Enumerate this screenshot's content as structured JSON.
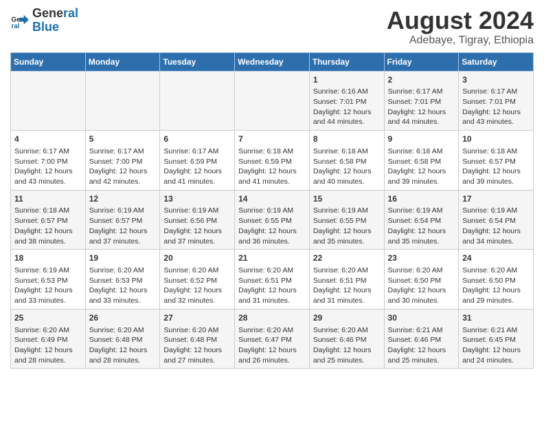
{
  "header": {
    "logo_line1": "General",
    "logo_line2": "Blue",
    "title": "August 2024",
    "subtitle": "Adebaye, Tigray, Ethiopia"
  },
  "calendar": {
    "days_of_week": [
      "Sunday",
      "Monday",
      "Tuesday",
      "Wednesday",
      "Thursday",
      "Friday",
      "Saturday"
    ],
    "weeks": [
      [
        {
          "day": "",
          "info": ""
        },
        {
          "day": "",
          "info": ""
        },
        {
          "day": "",
          "info": ""
        },
        {
          "day": "",
          "info": ""
        },
        {
          "day": "1",
          "info": "Sunrise: 6:16 AM\nSunset: 7:01 PM\nDaylight: 12 hours and 44 minutes."
        },
        {
          "day": "2",
          "info": "Sunrise: 6:17 AM\nSunset: 7:01 PM\nDaylight: 12 hours and 44 minutes."
        },
        {
          "day": "3",
          "info": "Sunrise: 6:17 AM\nSunset: 7:01 PM\nDaylight: 12 hours and 43 minutes."
        }
      ],
      [
        {
          "day": "4",
          "info": "Sunrise: 6:17 AM\nSunset: 7:00 PM\nDaylight: 12 hours and 43 minutes."
        },
        {
          "day": "5",
          "info": "Sunrise: 6:17 AM\nSunset: 7:00 PM\nDaylight: 12 hours and 42 minutes."
        },
        {
          "day": "6",
          "info": "Sunrise: 6:17 AM\nSunset: 6:59 PM\nDaylight: 12 hours and 41 minutes."
        },
        {
          "day": "7",
          "info": "Sunrise: 6:18 AM\nSunset: 6:59 PM\nDaylight: 12 hours and 41 minutes."
        },
        {
          "day": "8",
          "info": "Sunrise: 6:18 AM\nSunset: 6:58 PM\nDaylight: 12 hours and 40 minutes."
        },
        {
          "day": "9",
          "info": "Sunrise: 6:18 AM\nSunset: 6:58 PM\nDaylight: 12 hours and 39 minutes."
        },
        {
          "day": "10",
          "info": "Sunrise: 6:18 AM\nSunset: 6:57 PM\nDaylight: 12 hours and 39 minutes."
        }
      ],
      [
        {
          "day": "11",
          "info": "Sunrise: 6:18 AM\nSunset: 6:57 PM\nDaylight: 12 hours and 38 minutes."
        },
        {
          "day": "12",
          "info": "Sunrise: 6:19 AM\nSunset: 6:57 PM\nDaylight: 12 hours and 37 minutes."
        },
        {
          "day": "13",
          "info": "Sunrise: 6:19 AM\nSunset: 6:56 PM\nDaylight: 12 hours and 37 minutes."
        },
        {
          "day": "14",
          "info": "Sunrise: 6:19 AM\nSunset: 6:55 PM\nDaylight: 12 hours and 36 minutes."
        },
        {
          "day": "15",
          "info": "Sunrise: 6:19 AM\nSunset: 6:55 PM\nDaylight: 12 hours and 35 minutes."
        },
        {
          "day": "16",
          "info": "Sunrise: 6:19 AM\nSunset: 6:54 PM\nDaylight: 12 hours and 35 minutes."
        },
        {
          "day": "17",
          "info": "Sunrise: 6:19 AM\nSunset: 6:54 PM\nDaylight: 12 hours and 34 minutes."
        }
      ],
      [
        {
          "day": "18",
          "info": "Sunrise: 6:19 AM\nSunset: 6:53 PM\nDaylight: 12 hours and 33 minutes."
        },
        {
          "day": "19",
          "info": "Sunrise: 6:20 AM\nSunset: 6:53 PM\nDaylight: 12 hours and 33 minutes."
        },
        {
          "day": "20",
          "info": "Sunrise: 6:20 AM\nSunset: 6:52 PM\nDaylight: 12 hours and 32 minutes."
        },
        {
          "day": "21",
          "info": "Sunrise: 6:20 AM\nSunset: 6:51 PM\nDaylight: 12 hours and 31 minutes."
        },
        {
          "day": "22",
          "info": "Sunrise: 6:20 AM\nSunset: 6:51 PM\nDaylight: 12 hours and 31 minutes."
        },
        {
          "day": "23",
          "info": "Sunrise: 6:20 AM\nSunset: 6:50 PM\nDaylight: 12 hours and 30 minutes."
        },
        {
          "day": "24",
          "info": "Sunrise: 6:20 AM\nSunset: 6:50 PM\nDaylight: 12 hours and 29 minutes."
        }
      ],
      [
        {
          "day": "25",
          "info": "Sunrise: 6:20 AM\nSunset: 6:49 PM\nDaylight: 12 hours and 28 minutes."
        },
        {
          "day": "26",
          "info": "Sunrise: 6:20 AM\nSunset: 6:48 PM\nDaylight: 12 hours and 28 minutes."
        },
        {
          "day": "27",
          "info": "Sunrise: 6:20 AM\nSunset: 6:48 PM\nDaylight: 12 hours and 27 minutes."
        },
        {
          "day": "28",
          "info": "Sunrise: 6:20 AM\nSunset: 6:47 PM\nDaylight: 12 hours and 26 minutes."
        },
        {
          "day": "29",
          "info": "Sunrise: 6:20 AM\nSunset: 6:46 PM\nDaylight: 12 hours and 25 minutes."
        },
        {
          "day": "30",
          "info": "Sunrise: 6:21 AM\nSunset: 6:46 PM\nDaylight: 12 hours and 25 minutes."
        },
        {
          "day": "31",
          "info": "Sunrise: 6:21 AM\nSunset: 6:45 PM\nDaylight: 12 hours and 24 minutes."
        }
      ]
    ]
  }
}
